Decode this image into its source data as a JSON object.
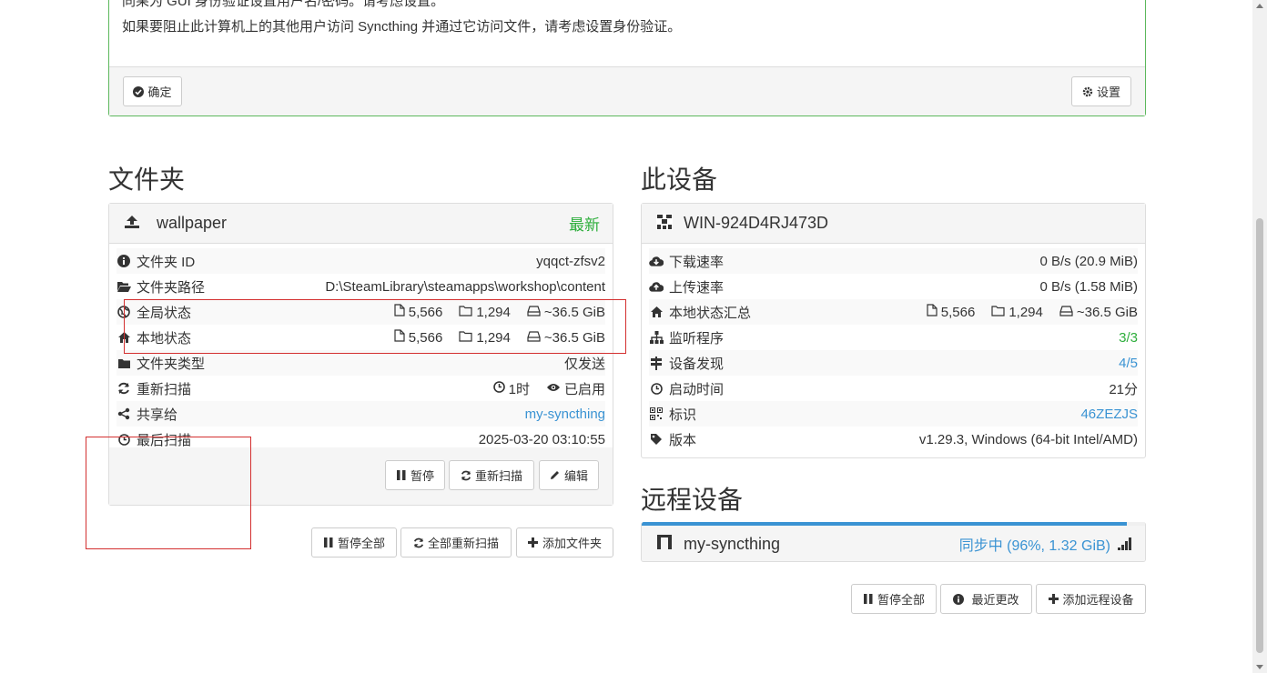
{
  "alert": {
    "line1": "同果为 GUI 身份验证设置用户名/密码。请考虑设置。",
    "line2": "如果要阻止此计算机上的其他用户访问 Syncthing 并通过它访问文件，请考虑设置身份验证。",
    "ok_label": "确定",
    "settings_label": "设置"
  },
  "folders": {
    "heading": "文件夹",
    "folder": {
      "name": "wallpaper",
      "status": "最新",
      "rows": [
        {
          "label": "文件夹 ID",
          "value": "yqqct-zfsv2"
        },
        {
          "label": "文件夹路径",
          "value": "D:\\SteamLibrary\\steamapps\\workshop\\content"
        },
        {
          "label": "全局状态",
          "files": "5,566",
          "dirs": "1,294",
          "size": "~36.5 GiB"
        },
        {
          "label": "本地状态",
          "files": "5,566",
          "dirs": "1,294",
          "size": "~36.5 GiB"
        },
        {
          "label": "文件夹类型",
          "value": "仅发送"
        },
        {
          "label": "重新扫描",
          "interval": "1时",
          "watch": "已启用"
        },
        {
          "label": "共享给",
          "value": "my-syncthing"
        },
        {
          "label": "最后扫描",
          "value": "2025-03-20 03:10:55"
        }
      ],
      "buttons": {
        "pause": "暂停",
        "rescan": "重新扫描",
        "edit": "编辑"
      }
    },
    "actions": {
      "pause_all": "暂停全部",
      "rescan_all": "全部重新扫描",
      "add_folder": "添加文件夹"
    }
  },
  "this_device": {
    "heading": "此设备",
    "name": "WIN-924D4RJ473D",
    "rows": [
      {
        "label": "下载速率",
        "value": "0 B/s (20.9 MiB)"
      },
      {
        "label": "上传速率",
        "value": "0 B/s (1.58 MiB)"
      },
      {
        "label": "本地状态汇总",
        "files": "5,566",
        "dirs": "1,294",
        "size": "~36.5 GiB"
      },
      {
        "label": "监听程序",
        "value": "3/3"
      },
      {
        "label": "设备发现",
        "value": "4/5"
      },
      {
        "label": "启动时间",
        "value": "21分"
      },
      {
        "label": "标识",
        "value": "46ZEZJS"
      },
      {
        "label": "版本",
        "value": "v1.29.3, Windows (64-bit Intel/AMD)"
      }
    ]
  },
  "remote": {
    "heading": "远程设备",
    "device": {
      "name": "my-syncthing",
      "status": "同步中 (96%, 1.32 GiB)",
      "progress": 0.96
    },
    "actions": {
      "pause_all": "暂停全部",
      "recent_changes": "最近更改",
      "add_device": "添加远程设备"
    }
  },
  "colors": {
    "green": "#2eae3c",
    "link": "#3a93d3",
    "annotation": "#d32f2f"
  }
}
